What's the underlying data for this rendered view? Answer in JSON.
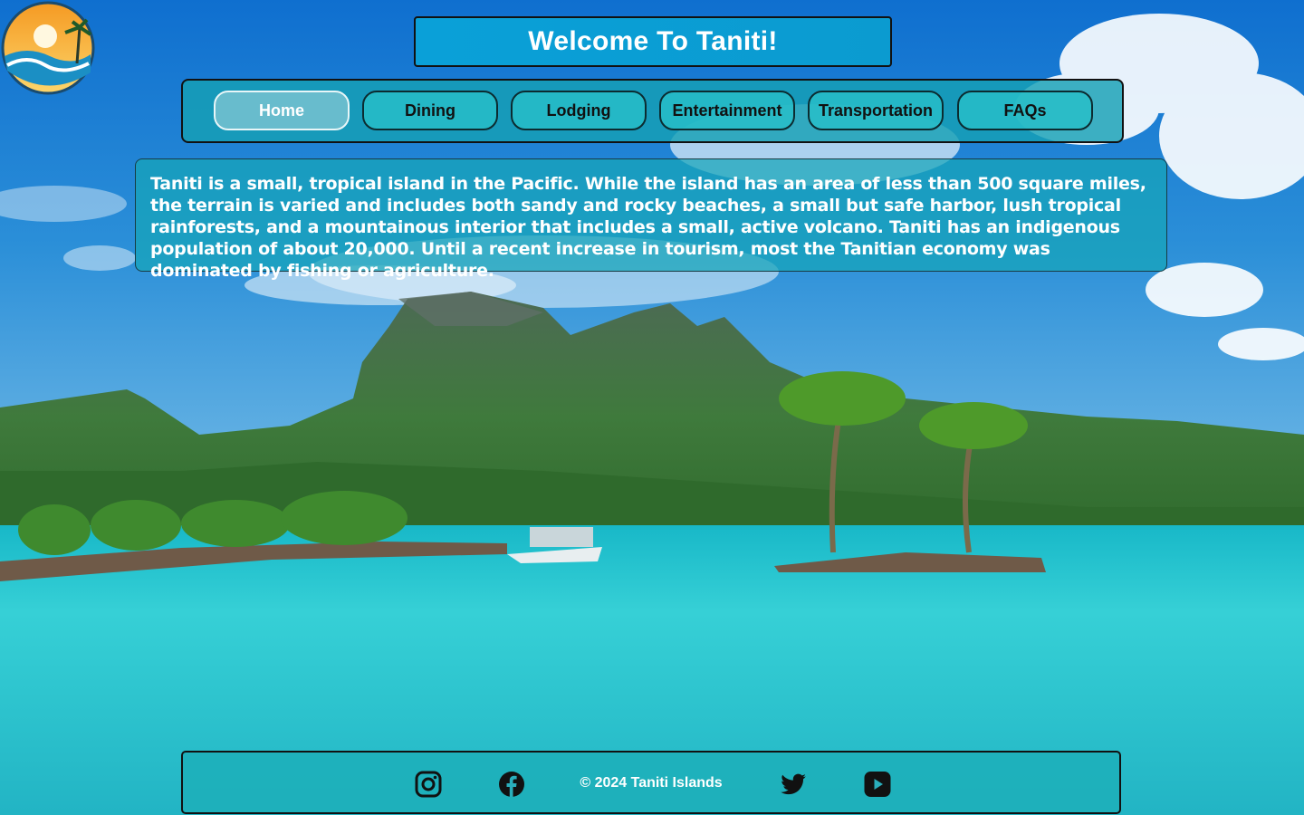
{
  "header": {
    "title": "Welcome To Taniti!"
  },
  "nav": {
    "items": [
      {
        "label": "Home",
        "active": true
      },
      {
        "label": "Dining",
        "active": false
      },
      {
        "label": "Lodging",
        "active": false
      },
      {
        "label": "Entertainment",
        "active": false
      },
      {
        "label": "Transportation",
        "active": false
      },
      {
        "label": "FAQs",
        "active": false
      }
    ]
  },
  "intro": {
    "text": "Taniti is a small, tropical island in the Pacific. While the island has an area of less than 500 square miles, the terrain is varied and includes both sandy and rocky beaches, a small but safe harbor, lush tropical rainforests, and a mountainous interior that includes a small, active volcano. Taniti has an indigenous population of about 20,000. Until a recent increase in tourism, most the Tanitian economy was dominated by fishing or agriculture."
  },
  "footer": {
    "copyright": "© 2024 Taniti Islands",
    "social": [
      "instagram-icon",
      "facebook-icon",
      "twitter-icon",
      "youtube-icon"
    ]
  },
  "colors": {
    "title_bg": "#0aa0d8",
    "panel_teal": "#16a0b4",
    "active_button": "#6ebecd",
    "sea": "#2ec9d2",
    "sky": "#1a86d0"
  }
}
